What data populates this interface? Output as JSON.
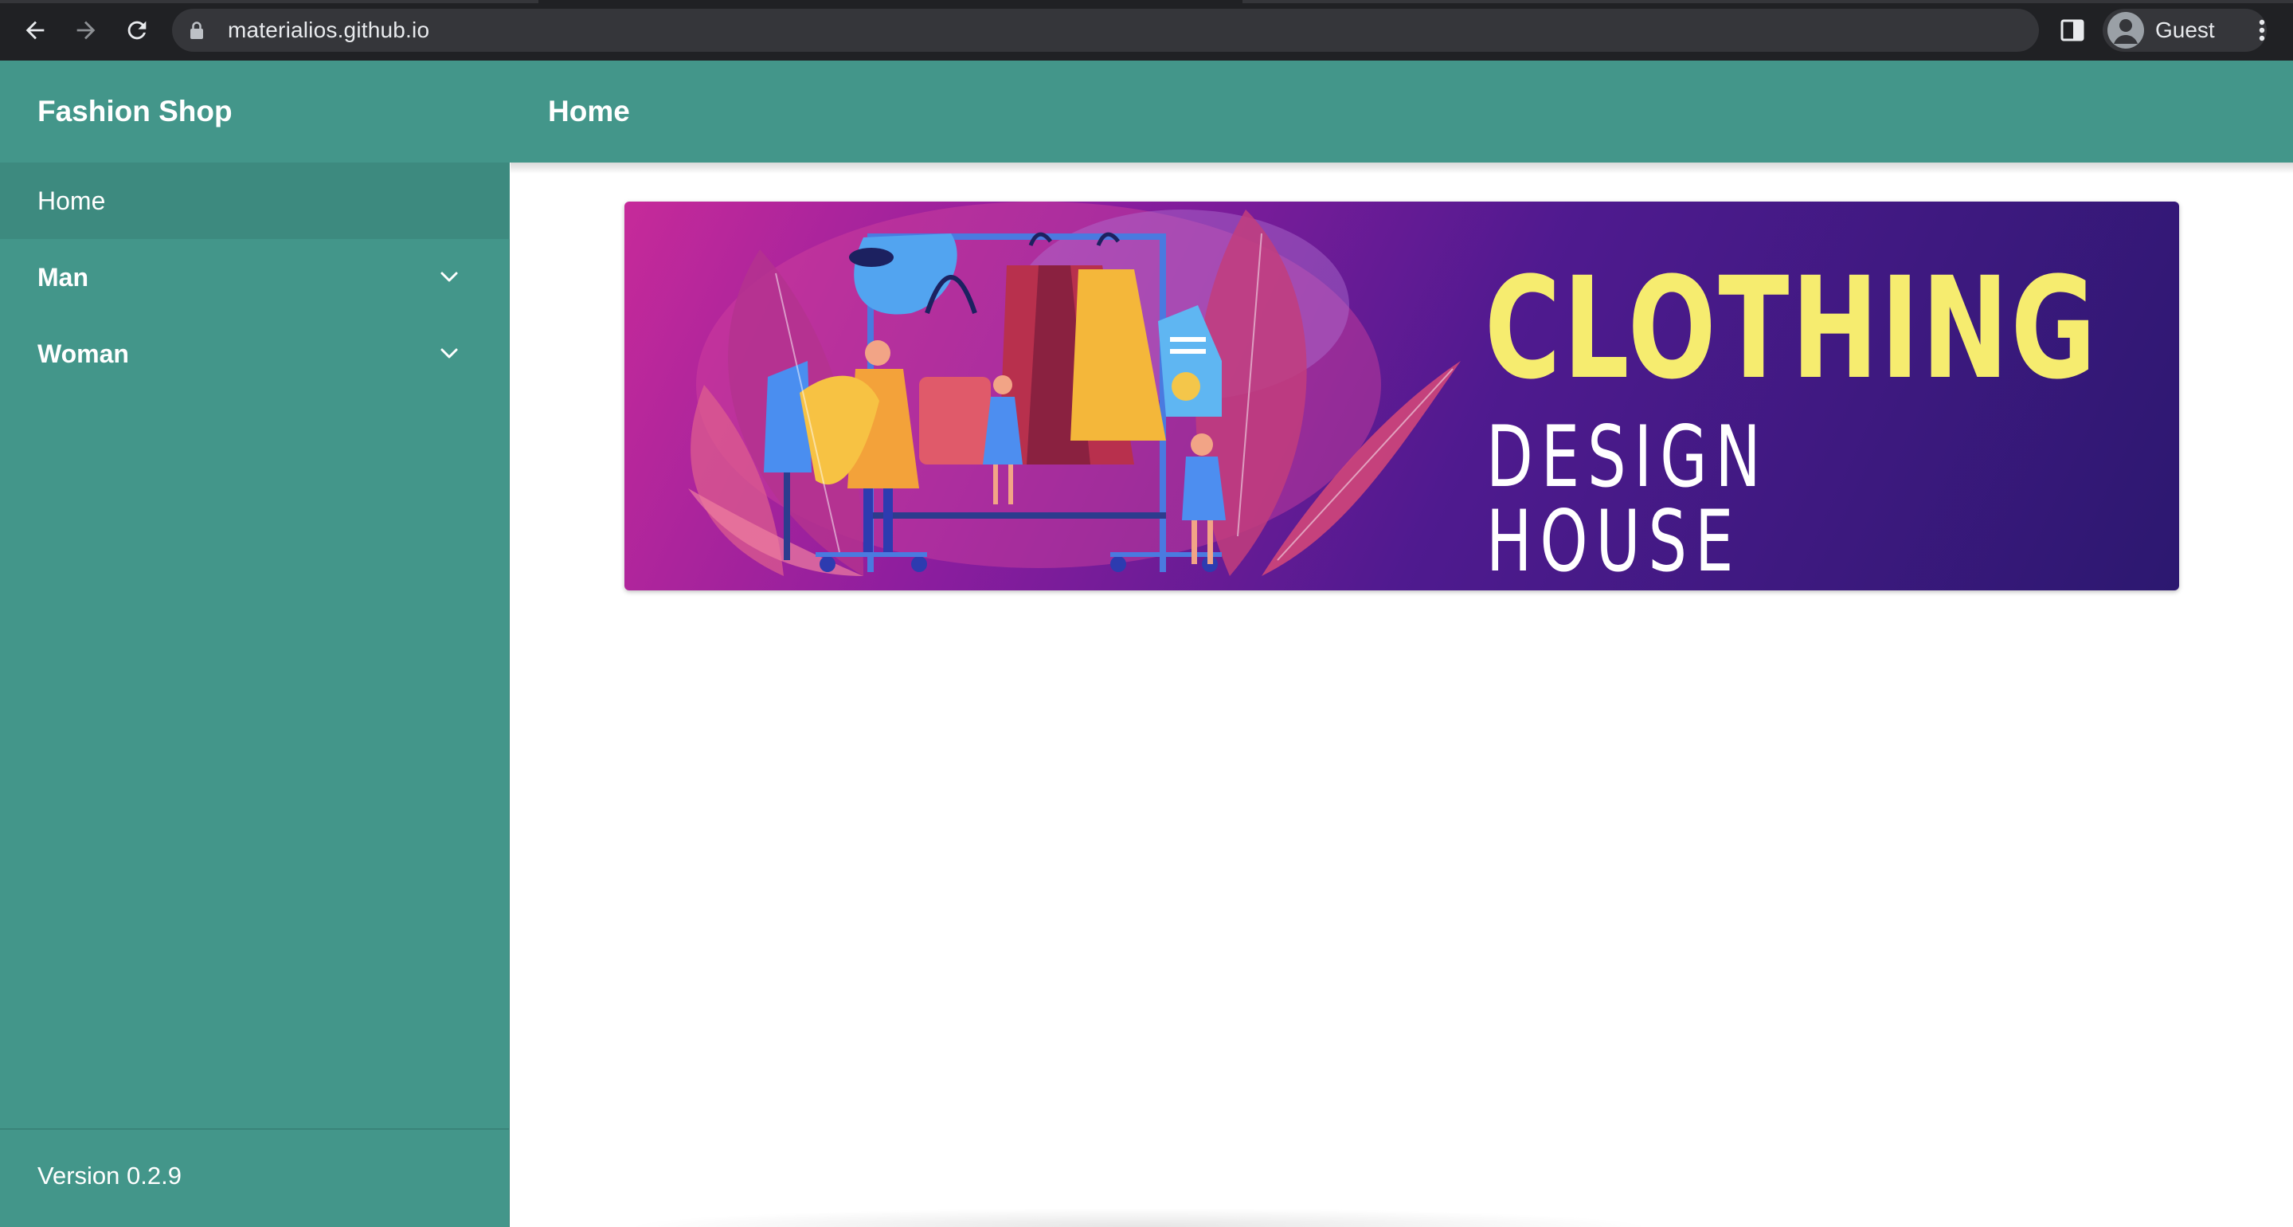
{
  "browser": {
    "url": "materialios.github.io",
    "profile_label": "Guest",
    "icons": [
      "back-arrow-icon",
      "forward-arrow-icon",
      "reload-icon",
      "lock-icon",
      "side-panel-icon",
      "profile-avatar-icon",
      "more-vert-icon"
    ]
  },
  "app": {
    "brand": "Fashion Shop",
    "page_title": "Home",
    "accent_color": "#43968a"
  },
  "sidebar": {
    "items": [
      {
        "label": "Home",
        "active": true,
        "expandable": false
      },
      {
        "label": "Man",
        "active": false,
        "expandable": true,
        "icon": "chevron-down-icon"
      },
      {
        "label": "Woman",
        "active": false,
        "expandable": true,
        "icon": "chevron-down-icon"
      }
    ],
    "version": "Version 0.2.9"
  },
  "banner": {
    "title": "CLOTHING",
    "subtitle": "DESIGN HOUSE",
    "title_color": "#f6ec6f"
  }
}
